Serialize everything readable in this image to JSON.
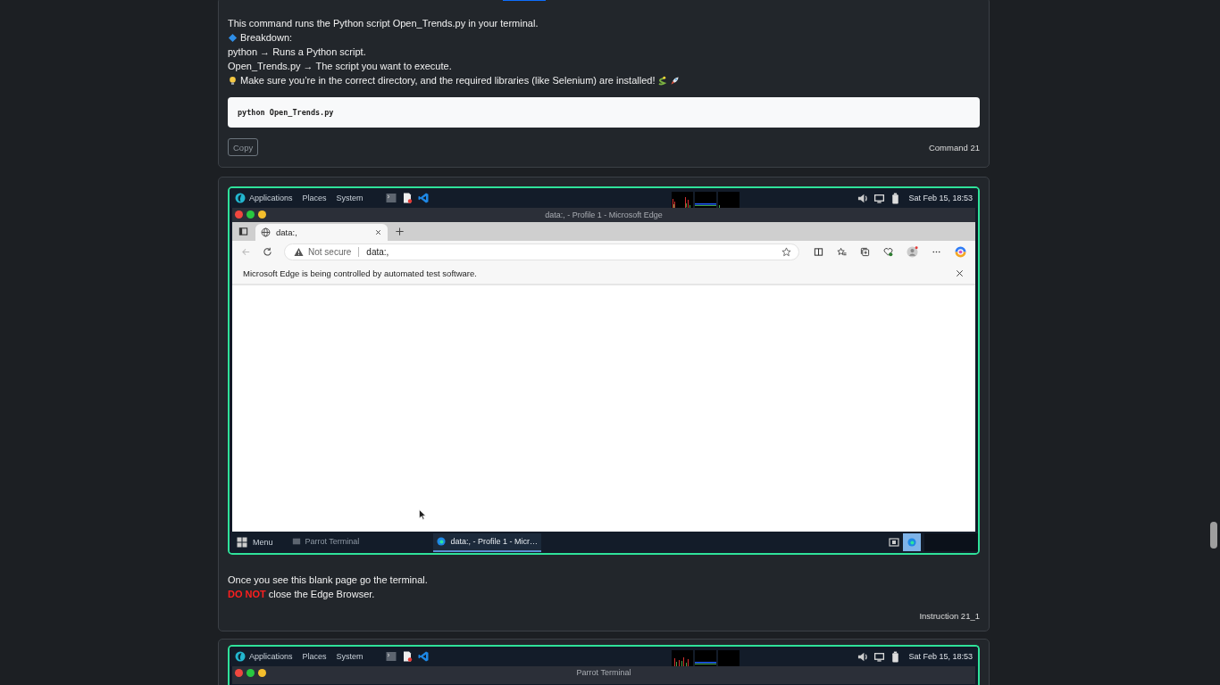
{
  "command_card": {
    "lines": [
      {
        "kind": "plain",
        "text": "This command runs the Python script Open_Trends.py in your terminal."
      },
      {
        "kind": "diamond",
        "text": "Breakdown:"
      },
      {
        "kind": "plain",
        "text": "python → Runs a Python script."
      },
      {
        "kind": "plain",
        "text": "Open_Trends.py → The script you want to execute."
      },
      {
        "kind": "tip",
        "text": "Make sure you’re in the correct directory, and the required libraries (like Selenium) are installed!"
      }
    ],
    "code": "python Open_Trends.py",
    "copy_button": "Copy",
    "label": "Command 21"
  },
  "instruction_card": {
    "screenshot": {
      "panel": {
        "menus": [
          "Applications",
          "Places",
          "System"
        ],
        "clock": "Sat Feb 15, 18:53"
      },
      "window_title": "data:, - Profile 1 - Microsoft Edge",
      "tab": "data:,",
      "security": "Not secure",
      "url": "data:,",
      "infobar": "Microsoft Edge is being controlled by automated test software.",
      "taskbar": {
        "menu": "Menu",
        "tasks": [
          {
            "kind": "terminal",
            "label": "Parrot Terminal",
            "selected": false
          },
          {
            "kind": "browser",
            "label": "data:, - Profile 1 - Micr…",
            "selected": true
          }
        ]
      }
    },
    "lines": [
      {
        "kind": "plain",
        "text": "Once you see this blank page go the terminal."
      },
      {
        "kind": "warning",
        "emphasis": "DO NOT",
        "text": "close the Edge Browser."
      }
    ],
    "label": "Instruction 21_1"
  },
  "next_card": {
    "screenshot": {
      "panel": {
        "menus": [
          "Applications",
          "Places",
          "System"
        ],
        "clock": "Sat Feb 15, 18:53"
      },
      "window_title": "Parrot Terminal"
    }
  }
}
